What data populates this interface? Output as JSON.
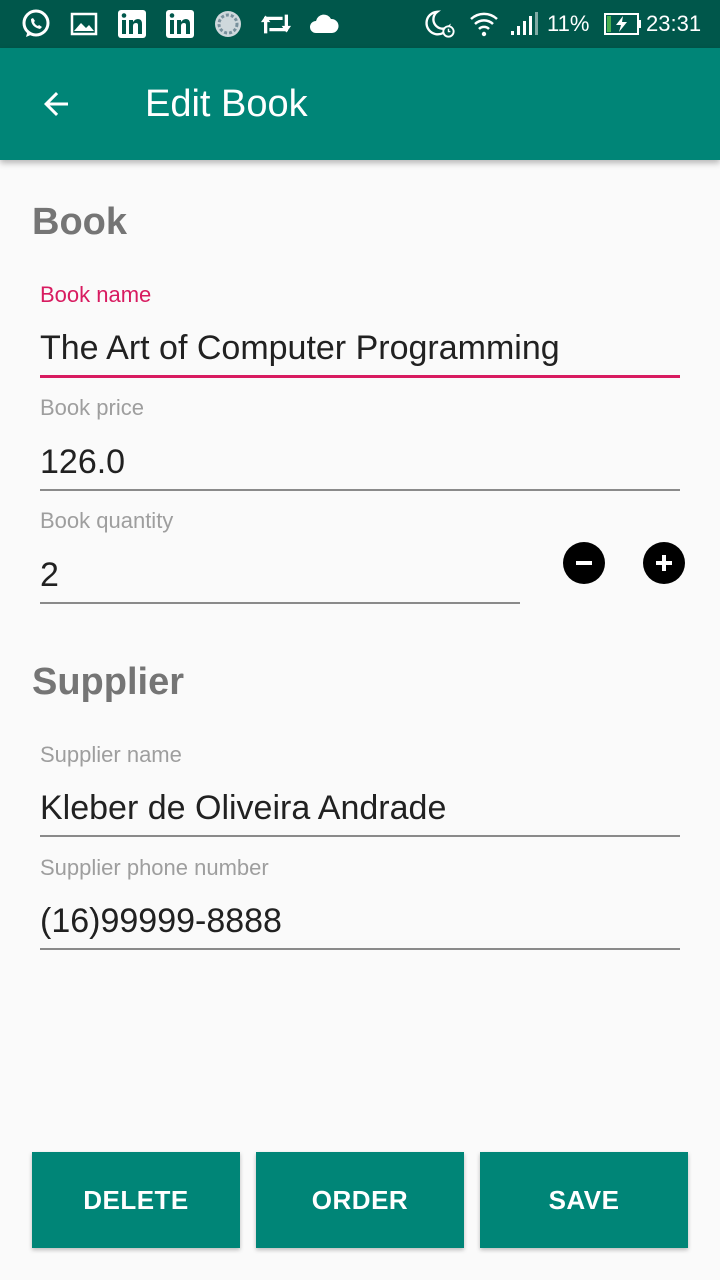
{
  "status_bar": {
    "battery_percent": "11%",
    "time": "23:31",
    "left_icons": [
      "whatsapp-icon",
      "image-icon",
      "linkedin-icon",
      "linkedin-icon",
      "sync-circle-icon",
      "retweet-icon",
      "cloud-icon"
    ],
    "right_icons": [
      "moon-alarm-icon",
      "wifi-icon",
      "signal-icon",
      "battery-charging-icon"
    ]
  },
  "app_bar": {
    "title": "Edit Book",
    "back_icon": "arrow-back-icon",
    "color": "#008577"
  },
  "book_section": {
    "title": "Book",
    "name": {
      "label": "Book name",
      "value": "The Art of Computer Programming"
    },
    "price": {
      "label": "Book price",
      "value": "126.0"
    },
    "quantity": {
      "label": "Book quantity",
      "value": "2"
    },
    "decrement_icon": "minus-circle-icon",
    "increment_icon": "plus-circle-icon"
  },
  "supplier_section": {
    "title": "Supplier",
    "name": {
      "label": "Supplier name",
      "value": "Kleber de Oliveira Andrade"
    },
    "phone": {
      "label": "Supplier phone number",
      "value": "(16)99999-8888"
    }
  },
  "actions": {
    "delete_label": "DELETE",
    "order_label": "ORDER",
    "save_label": "SAVE"
  },
  "colors": {
    "primary": "#008577",
    "primary_dark": "#00574b",
    "accent": "#d81b60"
  }
}
